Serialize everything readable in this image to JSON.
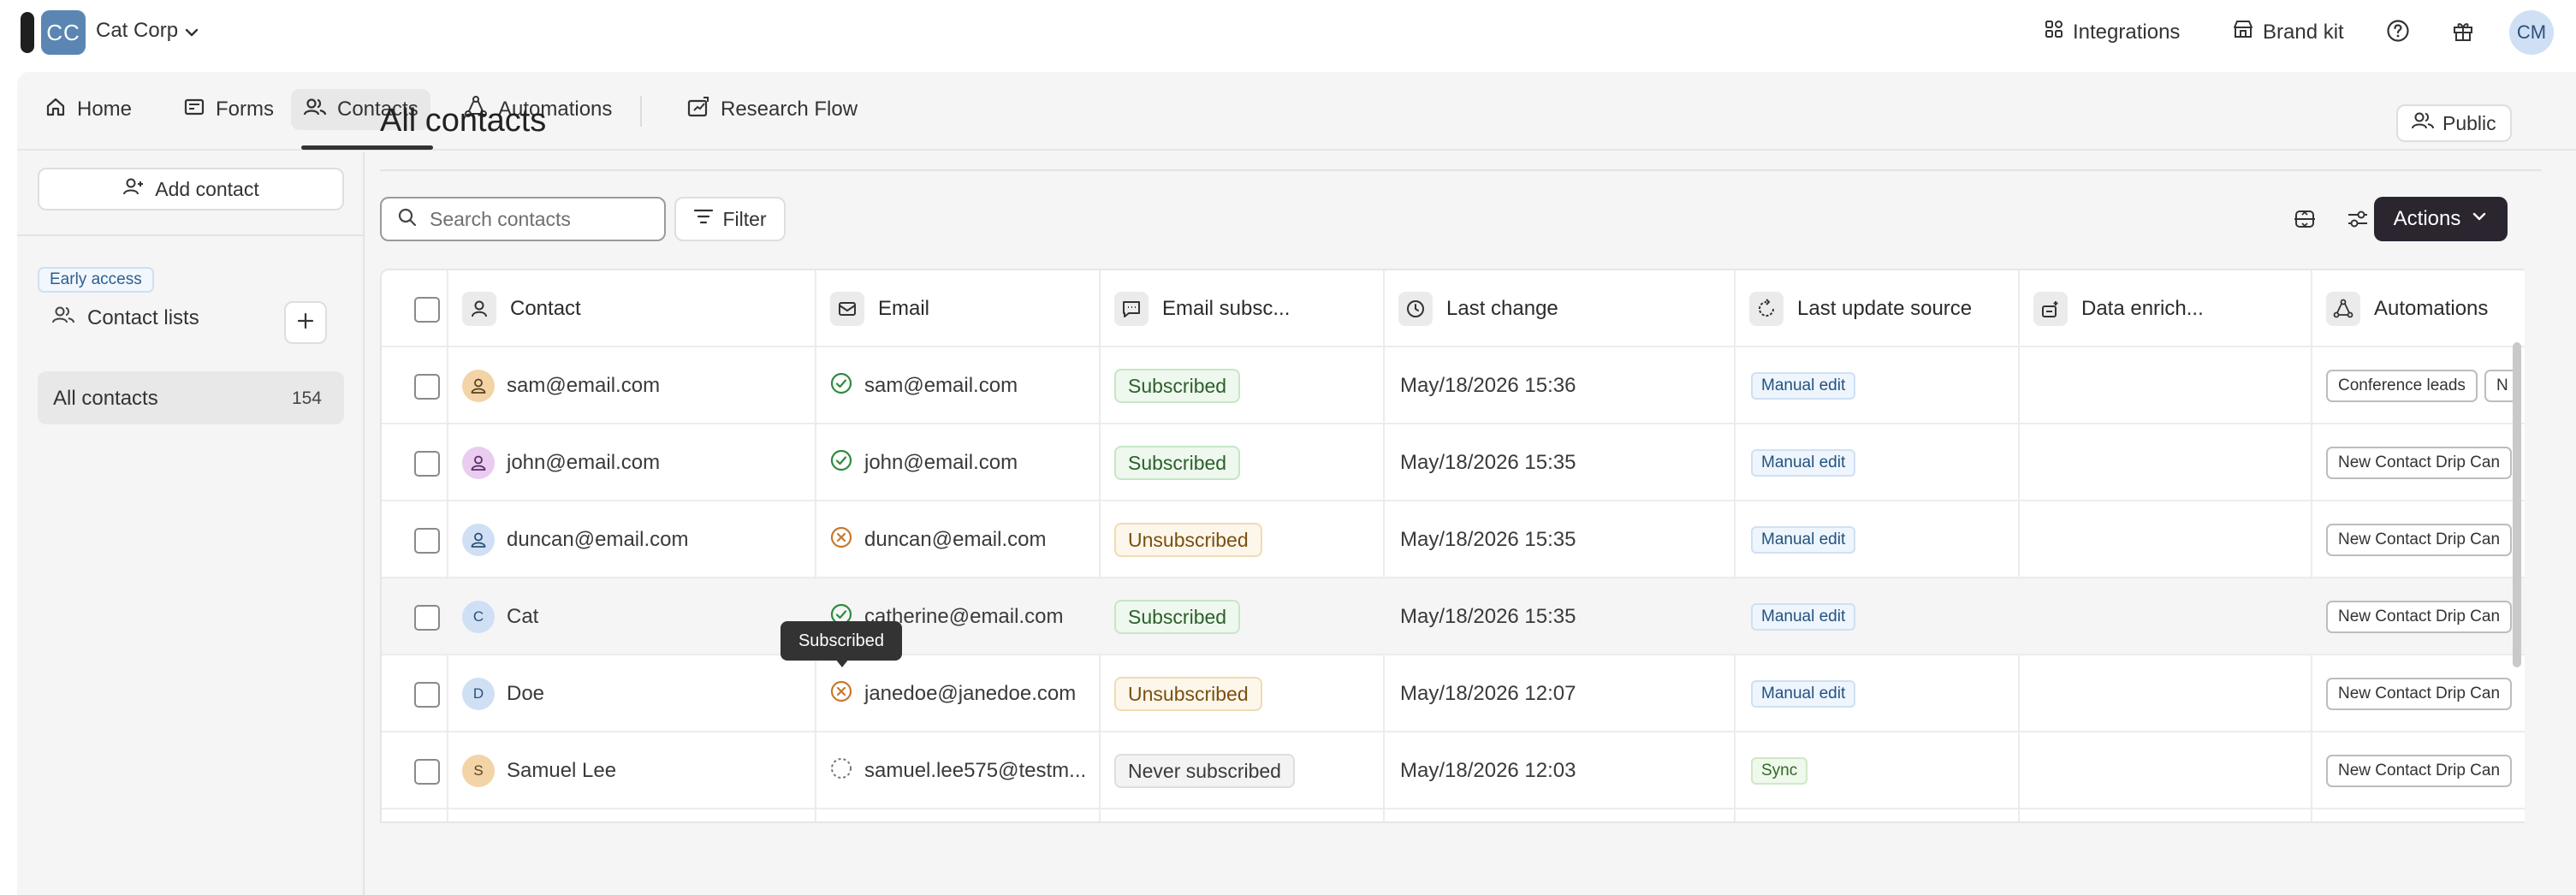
{
  "topbar": {
    "org_initials": "CC",
    "org_name": "Cat Corp",
    "integrations_label": "Integrations",
    "brand_kit_label": "Brand kit",
    "user_initials": "CM"
  },
  "tabs": [
    {
      "label": "Home",
      "icon": "home-icon"
    },
    {
      "label": "Forms",
      "icon": "forms-icon"
    },
    {
      "label": "Contacts",
      "icon": "contacts-icon",
      "active": true
    },
    {
      "label": "Automations",
      "icon": "automations-icon"
    },
    {
      "label": "Research Flow",
      "icon": "research-flow-icon"
    }
  ],
  "sidebar": {
    "add_contact_label": "Add contact",
    "early_access_badge": "Early access",
    "contact_lists_label": "Contact lists",
    "all_contacts_label": "All contacts",
    "all_contacts_count": "154"
  },
  "main": {
    "title": "All contacts",
    "public_label": "Public",
    "search_placeholder": "Search contacts",
    "filter_label": "Filter",
    "actions_label": "Actions"
  },
  "table": {
    "headers": [
      "Contact",
      "Email",
      "Email subsc...",
      "Last change",
      "Last update source",
      "Data enrich...",
      "Automations"
    ],
    "rows": [
      {
        "contact": "sam@email.com",
        "avatar": "",
        "avatar_color": "#f2d4a6",
        "email": "sam@email.com",
        "email_status": "subscribed",
        "subscription": "Subscribed",
        "last_change": "May/18/2026 15:36",
        "source": "Manual edit",
        "enrichment": "",
        "automations": [
          "Conference leads",
          "N"
        ]
      },
      {
        "contact": "john@email.com",
        "avatar": "",
        "avatar_color": "#e9ccf0",
        "email": "john@email.com",
        "email_status": "subscribed",
        "subscription": "Subscribed",
        "last_change": "May/18/2026 15:35",
        "source": "Manual edit",
        "enrichment": "",
        "automations": [
          "New Contact Drip Can"
        ]
      },
      {
        "contact": "duncan@email.com",
        "avatar": "",
        "avatar_color": "#cfe0f5",
        "email": "duncan@email.com",
        "email_status": "unsubscribed",
        "subscription": "Unsubscribed",
        "last_change": "May/18/2026 15:35",
        "source": "Manual edit",
        "enrichment": "",
        "automations": [
          "New Contact Drip Can"
        ]
      },
      {
        "contact": "Cat",
        "avatar": "C",
        "avatar_color": "#cfe0f5",
        "email": "catherine@email.com",
        "email_status": "subscribed",
        "subscription": "Subscribed",
        "last_change": "May/18/2026 15:35",
        "source": "Manual edit",
        "enrichment": "",
        "automations": [
          "New Contact Drip Can"
        ]
      },
      {
        "contact": "Doe",
        "avatar": "D",
        "avatar_color": "#cfe0f5",
        "email": "janedoe@janedoe.com",
        "email_status": "unsubscribed",
        "subscription": "Unsubscribed",
        "last_change": "May/18/2026 12:07",
        "source": "Manual edit",
        "enrichment": "",
        "automations": [
          "New Contact Drip Can"
        ]
      },
      {
        "contact": "Samuel Lee",
        "avatar": "S",
        "avatar_color": "#f2d4a6",
        "email": "samuel.lee575@testm...",
        "email_status": "never",
        "subscription": "Never subscribed",
        "last_change": "May/18/2026 12:03",
        "source": "Sync",
        "enrichment": "",
        "automations": [
          "New Contact Drip Can"
        ]
      }
    ]
  },
  "tooltip": {
    "text": "Subscribed"
  },
  "colors": {
    "accent_dark": "#2b2530",
    "subscribed_green": "#2e8b3e",
    "unsubscribed_orange": "#c9782a",
    "badge_blue": "#23527f"
  }
}
